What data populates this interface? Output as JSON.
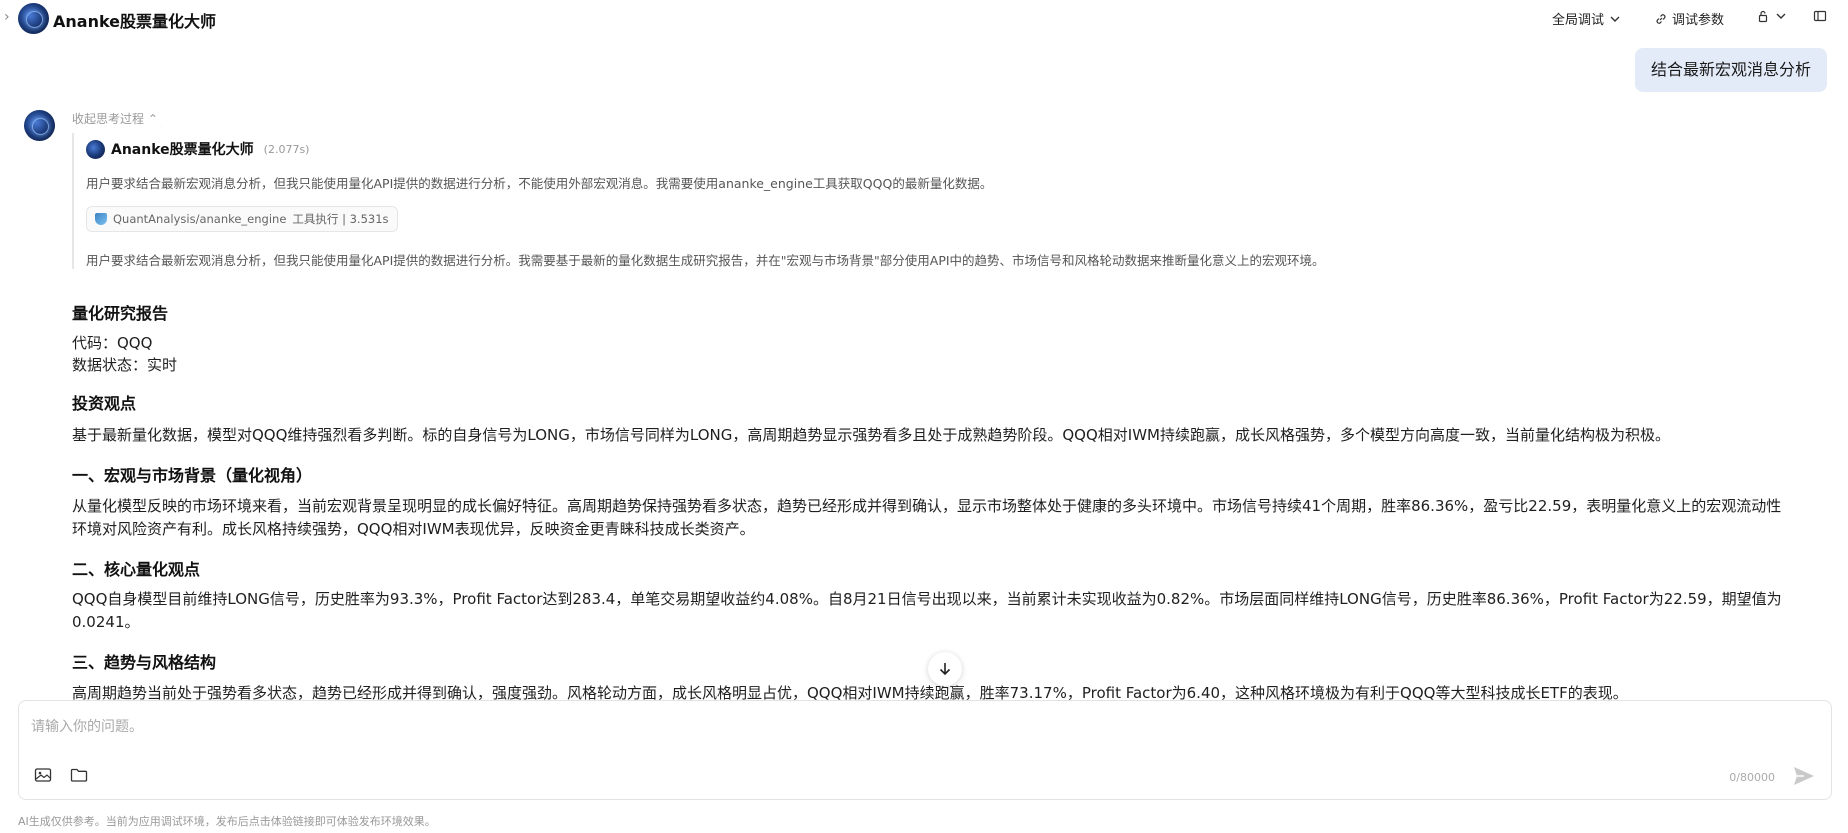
{
  "header": {
    "title": "Ananke股票量化大师",
    "global_debug_label": "全局调试",
    "debug_params_label": "调试参数"
  },
  "user_message": "结合最新宏观消息分析",
  "assistant": {
    "collapse_thinking_label": "收起思考过程",
    "thinking": {
      "agent_name": "Ananke股票量化大师",
      "duration": "(2.077s)",
      "text1": "用户要求结合最新宏观消息分析，但我只能使用量化API提供的数据进行分析，不能使用外部宏观消息。我需要使用ananke_engine工具获取QQQ的最新量化数据。",
      "tool_name": "QuantAnalysis/ananke_engine",
      "tool_status": "工具执行 | 3.531s",
      "text2": "用户要求结合最新宏观消息分析，但我只能使用量化API提供的数据进行分析。我需要基于最新的量化数据生成研究报告，并在\"宏观与市场背景\"部分使用API中的趋势、市场信号和风格轮动数据来推断量化意义上的宏观环境。"
    },
    "report": {
      "title": "量化研究报告",
      "code_line": "代码：QQQ",
      "status_line": "数据状态：实时",
      "s1_title": "投资观点",
      "s1_text": "基于最新量化数据，模型对QQQ维持强烈看多判断。标的自身信号为LONG，市场信号同样为LONG，高周期趋势显示强势看多且处于成熟趋势阶段。QQQ相对IWM持续跑赢，成长风格强势，多个模型方向高度一致，当前量化结构极为积极。",
      "s2_title": "一、宏观与市场背景（量化视角）",
      "s2_text": "从量化模型反映的市场环境来看，当前宏观背景呈现明显的成长偏好特征。高周期趋势保持强势看多状态，趋势已经形成并得到确认，显示市场整体处于健康的多头环境中。市场信号持续41个周期，胜率86.36%，盈亏比22.59，表明量化意义上的宏观流动性环境对风险资产有利。成长风格持续强势，QQQ相对IWM表现优异，反映资金更青睐科技成长类资产。",
      "s3_title": "二、核心量化观点",
      "s3_text": "QQQ自身模型目前维持LONG信号，历史胜率为93.3%，Profit Factor达到283.4，单笔交易期望收益约4.08%。自8月21日信号出现以来，当前累计未实现收益为0.82%。市场层面同样维持LONG信号，历史胜率86.36%，Profit Factor为22.59，期望值为0.0241。",
      "s4_title": "三、趋势与风格结构",
      "s4_text": "高周期趋势当前处于强势看多状态，趋势已经形成并得到确认，强度强劲。风格轮动方面，成长风格明显占优，QQQ相对IWM持续跑赢，胜率73.17%，Profit Factor为6.40，这种风格环境极为有利于QQQ等大型科技成长ETF的表现。"
    }
  },
  "input": {
    "placeholder": "请输入你的问题。",
    "counter": "0/80000"
  },
  "disclaimer": "AI生成仅供参考。当前为应用调试环境，发布后点击体验链接即可体验发布环境效果。",
  "icons": [
    "chevron-right-icon",
    "chevron-down-icon",
    "link-icon",
    "lock-icon",
    "sidebar-icon",
    "image-icon",
    "folder-icon",
    "send-icon",
    "arrow-down-icon",
    "shield-icon"
  ]
}
